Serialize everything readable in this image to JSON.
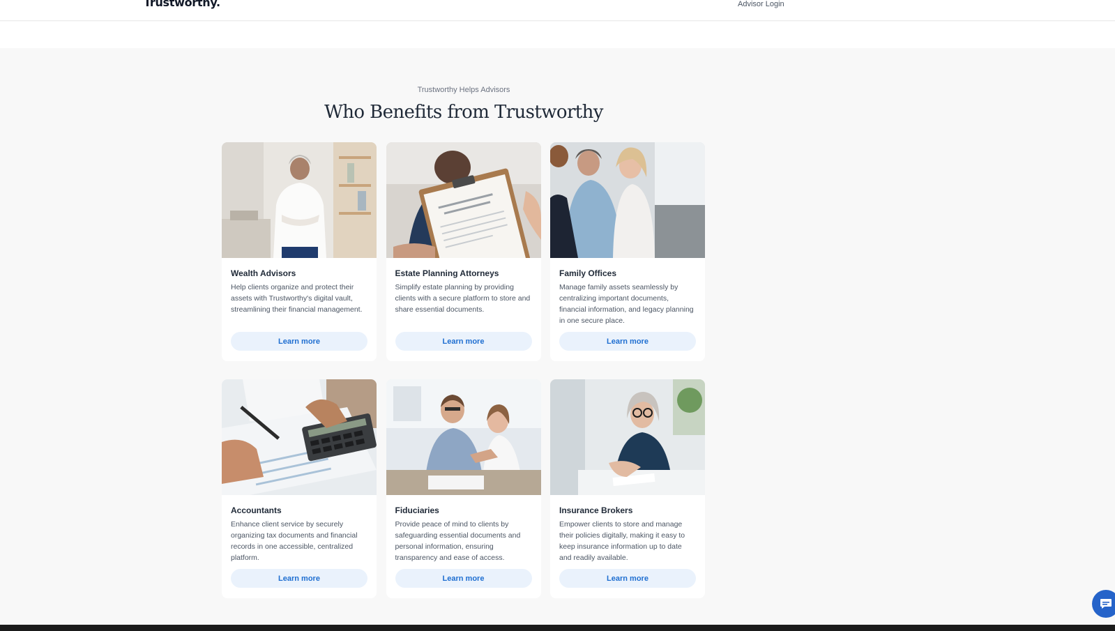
{
  "header": {
    "logo": "Trustworthy.",
    "advisor_login": "Advisor Login"
  },
  "section": {
    "eyebrow": "Trustworthy Helps Advisors",
    "title": "Who Benefits from Trustworthy"
  },
  "cards": [
    {
      "title": "Wealth Advisors",
      "description": "Help clients organize and protect their assets with Trustworthy's digital vault, streamlining their financial management.",
      "button": "Learn more"
    },
    {
      "title": "Estate Planning Attorneys",
      "description": "Simplify estate planning by providing clients with a secure platform to store and share essential documents.",
      "button": "Learn more"
    },
    {
      "title": "Family Offices",
      "description": "Manage family assets seamlessly by centralizing important documents, financial information, and legacy planning in one secure place.",
      "button": "Learn more"
    },
    {
      "title": "Accountants",
      "description": "Enhance client service by securely organizing tax documents and financial records in one accessible, centralized platform.",
      "button": "Learn more"
    },
    {
      "title": "Fiduciaries",
      "description": "Provide peace of mind to clients by safeguarding essential documents and personal information, ensuring transparency and ease of access.",
      "button": "Learn more"
    },
    {
      "title": "Insurance Brokers",
      "description": "Empower clients to store and manage their policies digitally, making it easy to keep insurance information up to date and readily available.",
      "button": "Learn more"
    }
  ],
  "colors": {
    "page_background": "#f8f8f8",
    "card_background": "#ffffff",
    "button_background": "#eaf2fc",
    "button_text": "#1f6fd1",
    "chat_button": "#2563c9",
    "footer": "#1b1b1b"
  },
  "icons": {
    "chat": "chat-bubble-icon"
  }
}
